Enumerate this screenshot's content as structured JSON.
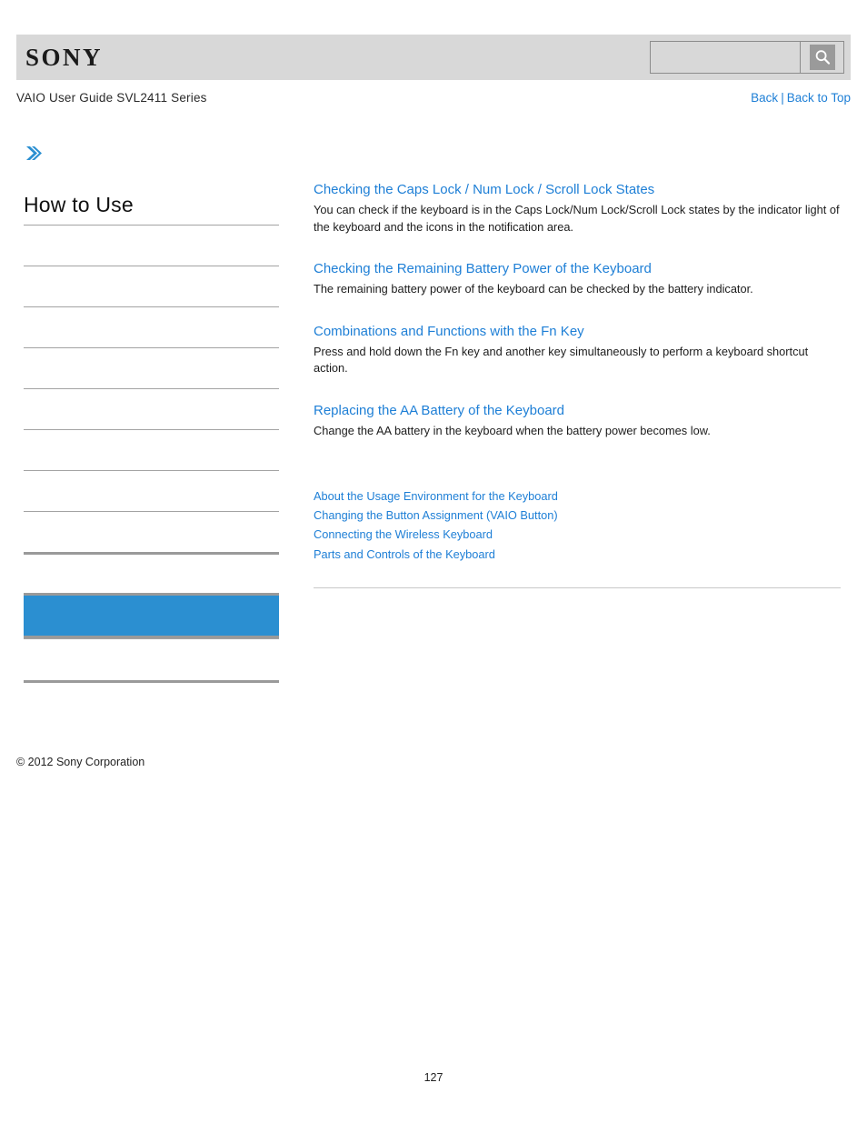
{
  "header": {
    "logo_text": "SONY",
    "search": {
      "value": "",
      "placeholder": "",
      "button_icon": "search-icon"
    }
  },
  "subheader": {
    "title": "VAIO User Guide SVL2411 Series",
    "back_label": "Back",
    "separator": "|",
    "back_to_top_label": "Back to Top"
  },
  "sidebar": {
    "breadcrumb_icon": "double-chevron-right-icon",
    "title": "How to Use",
    "items": [
      {
        "label": "",
        "selected": false
      },
      {
        "label": "",
        "selected": false
      },
      {
        "label": "",
        "selected": false
      },
      {
        "label": "",
        "selected": false
      },
      {
        "label": "",
        "selected": false
      },
      {
        "label": "",
        "selected": false
      },
      {
        "label": "",
        "selected": false
      },
      {
        "label": "",
        "selected": false
      },
      {
        "label": "",
        "selected": true
      },
      {
        "label": "",
        "selected": false
      },
      {
        "label": "",
        "selected": false
      }
    ],
    "copyright": "© 2012 Sony Corporation"
  },
  "main": {
    "topics": [
      {
        "title": "Checking the Caps Lock / Num Lock / Scroll Lock States",
        "description": "You can check if the keyboard is in the Caps Lock/Num Lock/Scroll Lock states by the indicator light of the keyboard and the icons in the notification area."
      },
      {
        "title": "Checking the Remaining Battery Power of the Keyboard",
        "description": "The remaining battery power of the keyboard can be checked by the battery indicator."
      },
      {
        "title": "Combinations and Functions with the Fn Key",
        "description": "Press and hold down the Fn key and another key simultaneously to perform a keyboard shortcut action."
      },
      {
        "title": "Replacing the AA Battery of the Keyboard",
        "description": "Change the AA battery in the keyboard when the battery power becomes low."
      }
    ],
    "related_links": [
      "About the Usage Environment for the Keyboard",
      "Changing the Button Assignment (VAIO Button)",
      "Connecting the Wireless Keyboard",
      "Parts and Controls of the Keyboard"
    ]
  },
  "footer": {
    "page_number": "127"
  },
  "colors": {
    "link_blue": "#1e7fd6",
    "selected_blue": "#2b8fd1",
    "brandbar_gray": "#d8d8d8",
    "rule_gray": "#a3a3a3"
  }
}
